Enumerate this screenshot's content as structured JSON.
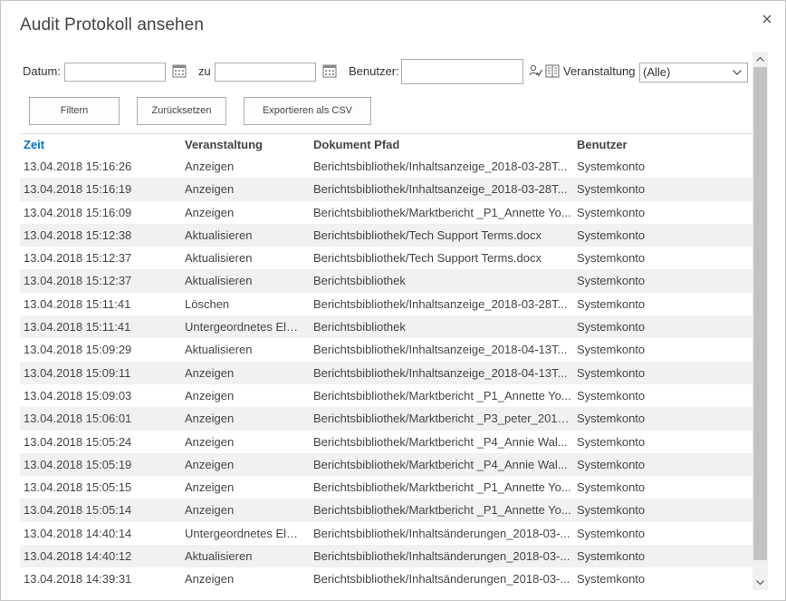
{
  "dialog": {
    "title": "Audit Protokoll ansehen"
  },
  "filters": {
    "date_label": "Datum:",
    "date_from_value": "",
    "to_label": "zu",
    "date_to_value": "",
    "user_label": "Benutzer:",
    "user_value": "",
    "event_label": "Veranstaltung",
    "event_selected": "(Alle)"
  },
  "buttons": {
    "filter": "Filtern",
    "reset": "Zurücksetzen",
    "export": "Exportieren als CSV"
  },
  "table": {
    "columns": [
      "Zeit",
      "Veranstaltung",
      "Dokument Pfad",
      "Benutzer"
    ],
    "sorted_column": "Zeit",
    "rows": [
      [
        "13.04.2018 15:16:26",
        "Anzeigen",
        "Berichtsbibliothek/Inhaltsanzeige_2018-03-28T...",
        "Systemkonto"
      ],
      [
        "13.04.2018 15:16:19",
        "Anzeigen",
        "Berichtsbibliothek/Inhaltsanzeige_2018-03-28T...",
        "Systemkonto"
      ],
      [
        "13.04.2018 15:16:09",
        "Anzeigen",
        "Berichtsbibliothek/Marktbericht _P1_Annette Yo...",
        "Systemkonto"
      ],
      [
        "13.04.2018 15:12:38",
        "Aktualisieren",
        "Berichtsbibliothek/Tech Support Terms.docx",
        "Systemkonto"
      ],
      [
        "13.04.2018 15:12:37",
        "Aktualisieren",
        "Berichtsbibliothek/Tech Support Terms.docx",
        "Systemkonto"
      ],
      [
        "13.04.2018 15:12:37",
        "Aktualisieren",
        "Berichtsbibliothek",
        "Systemkonto"
      ],
      [
        "13.04.2018 15:11:41",
        "Löschen",
        "Berichtsbibliothek/Inhaltsanzeige_2018-03-28T...",
        "Systemkonto"
      ],
      [
        "13.04.2018 15:11:41",
        "Untergeordnetes Ele...",
        "Berichtsbibliothek",
        "Systemkonto"
      ],
      [
        "13.04.2018 15:09:29",
        "Aktualisieren",
        "Berichtsbibliothek/Inhaltsanzeige_2018-04-13T...",
        "Systemkonto"
      ],
      [
        "13.04.2018 15:09:11",
        "Anzeigen",
        "Berichtsbibliothek/Inhaltsanzeige_2018-04-13T...",
        "Systemkonto"
      ],
      [
        "13.04.2018 15:09:03",
        "Anzeigen",
        "Berichtsbibliothek/Marktbericht _P1_Annette Yo...",
        "Systemkonto"
      ],
      [
        "13.04.2018 15:06:01",
        "Anzeigen",
        "Berichtsbibliothek/Marktbericht _P3_peter_2018...",
        "Systemkonto"
      ],
      [
        "13.04.2018 15:05:24",
        "Anzeigen",
        "Berichtsbibliothek/Marktbericht _P4_Annie Wal...",
        "Systemkonto"
      ],
      [
        "13.04.2018 15:05:19",
        "Anzeigen",
        "Berichtsbibliothek/Marktbericht _P4_Annie Wal...",
        "Systemkonto"
      ],
      [
        "13.04.2018 15:05:15",
        "Anzeigen",
        "Berichtsbibliothek/Marktbericht _P1_Annette Yo...",
        "Systemkonto"
      ],
      [
        "13.04.2018 15:05:14",
        "Anzeigen",
        "Berichtsbibliothek/Marktbericht _P1_Annette Yo...",
        "Systemkonto"
      ],
      [
        "13.04.2018 14:40:14",
        "Untergeordnetes Ele...",
        "Berichtsbibliothek/Inhaltsänderungen_2018-03-...",
        "Systemkonto"
      ],
      [
        "13.04.2018 14:40:12",
        "Aktualisieren",
        "Berichtsbibliothek/Inhaltsänderungen_2018-03-...",
        "Systemkonto"
      ],
      [
        "13.04.2018 14:39:31",
        "Anzeigen",
        "Berichtsbibliothek/Inhaltsänderungen_2018-03-...",
        "Systemkonto"
      ]
    ]
  },
  "icons": {
    "close": "close-icon",
    "calendar": "calendar-icon",
    "people_picker": "people-picker-icon",
    "address_book": "address-book-icon",
    "dropdown": "chevron-down-icon"
  },
  "colors": {
    "accent": "#0072c6",
    "alt_row": "#f1f1f1",
    "scroll_thumb": "#c2c2c2"
  }
}
